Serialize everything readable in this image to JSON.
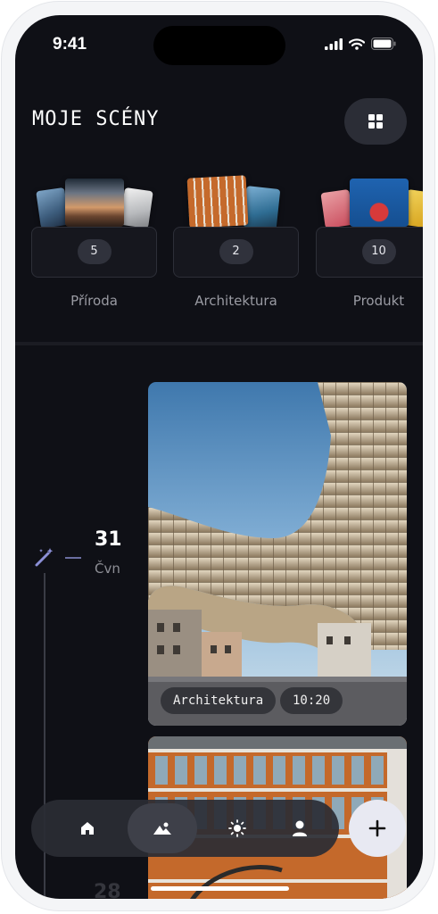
{
  "status_bar": {
    "time": "9:41"
  },
  "header": {
    "title": "MOJE SCÉNY"
  },
  "scenes": [
    {
      "label": "Příroda",
      "count": "5"
    },
    {
      "label": "Architektura",
      "count": "2"
    },
    {
      "label": "Produkt",
      "count": "10"
    }
  ],
  "timeline": {
    "day": "31",
    "month": "Čvn",
    "next_day": "28",
    "photo": {
      "category": "Architektura",
      "time": "10:20"
    }
  },
  "colors": {
    "background": "#0f1016",
    "accent": "#8b8fd6",
    "tab_active": "#3e4049",
    "fab": "#e8e9f2"
  },
  "icons": {
    "grid": "grid-icon",
    "timeline": "magic-wand-icon",
    "tabs": [
      "home-icon",
      "landscape-icon",
      "sun-icon",
      "user-icon"
    ],
    "fab": "plus-icon"
  }
}
